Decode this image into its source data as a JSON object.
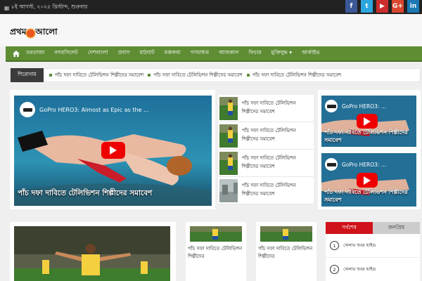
{
  "topbar": {
    "date": "৮ই আগস্ট, ২০২৫ খ্রিস্টাব্দ, শুক্রবার",
    "social": [
      {
        "label": "f",
        "color": "#3b5998",
        "icon": "facebook-icon"
      },
      {
        "label": "t",
        "color": "#2ba6de",
        "icon": "twitter-icon"
      },
      {
        "label": "▶",
        "color": "#cc2d2d",
        "icon": "youtube-icon"
      },
      {
        "label": "G+",
        "color": "#d9462f",
        "icon": "google-plus-icon"
      },
      {
        "label": "in",
        "color": "#1b78b4",
        "icon": "linkedin-icon"
      }
    ]
  },
  "logo": {
    "part1": "প্রথম",
    "part2": "আলো"
  },
  "nav": {
    "items": [
      "তরতাজা",
      "নগরসিলেট",
      "দেশবাংলা",
      "প্রবাস",
      "মাঠঘাট",
      "মঞ্চকথা",
      "গণমাধ্যম",
      "আজকাল",
      "ফিচার",
      "মুক্তিযুদ্ধ ▾",
      "আর্কাইভ"
    ]
  },
  "ticker": {
    "label": "শিরোনাম",
    "items": [
      "পাঁচ দফা দাবিতে টেলিভিশন শিল্পীদের সমাবেশ",
      "পাঁচ দফা দাবিতে টেলিভিশন শিল্পীদের সমাবেশ",
      "পাঁচ দফা দাবিতে টেলিভিশন শিল্পীদের সমাবেশ"
    ]
  },
  "featured": {
    "video_title": "GoPro HERO3: Almost as Epic as the ...",
    "caption": "পাঁচ দফা দাবিতে টেলিভিশন শিল্পীদের সমাবেশ"
  },
  "side_list": [
    {
      "text": "পাঁচ দফা দাবিতে টেলিভিশন শিল্পীদের সমাবেশ"
    },
    {
      "text": "পাঁচ দফা দাবিতে টেলিভিশন শিল্পীদের সমাবেশ"
    },
    {
      "text": "পাঁচ দফা দাবিতে টেলিভিশন শিল্পীদের সমাবেশ"
    },
    {
      "text": "পাঁচ দফা দাবিতে টেলিভিশন শিল্পীদের সমাবেশ"
    }
  ],
  "right_videos": [
    {
      "title": "GoPro HERO3: ...",
      "caption": "পাঁচ দফা দাবিতে টেলিভিশন শিল্পীদের সমাবেশ"
    },
    {
      "title": "GoPro HERO3: ...",
      "caption": "পাঁচ দফা দাবিতে টেলিভিশন শিল্পীদের সমাবেশ"
    }
  ],
  "bottom_cards": [
    {
      "caption": "পাঁচ দফা দাবিতে টেলিভিশন শিল্পীদের"
    },
    {
      "caption": "পাঁচ দফা দাবিতে টেলিভিশন শিল্পীদের"
    }
  ],
  "tabs": {
    "latest": "সর্বশেষ",
    "popular": "জনপ্রিয়",
    "items": [
      {
        "num": "1",
        "text": "খেলার খবর হাইড"
      },
      {
        "num": "2",
        "text": "খেলার খবর হাইড"
      }
    ]
  },
  "colors": {
    "nav": "#5e8d34",
    "accent": "#d0121a",
    "topbar": "#222222"
  }
}
